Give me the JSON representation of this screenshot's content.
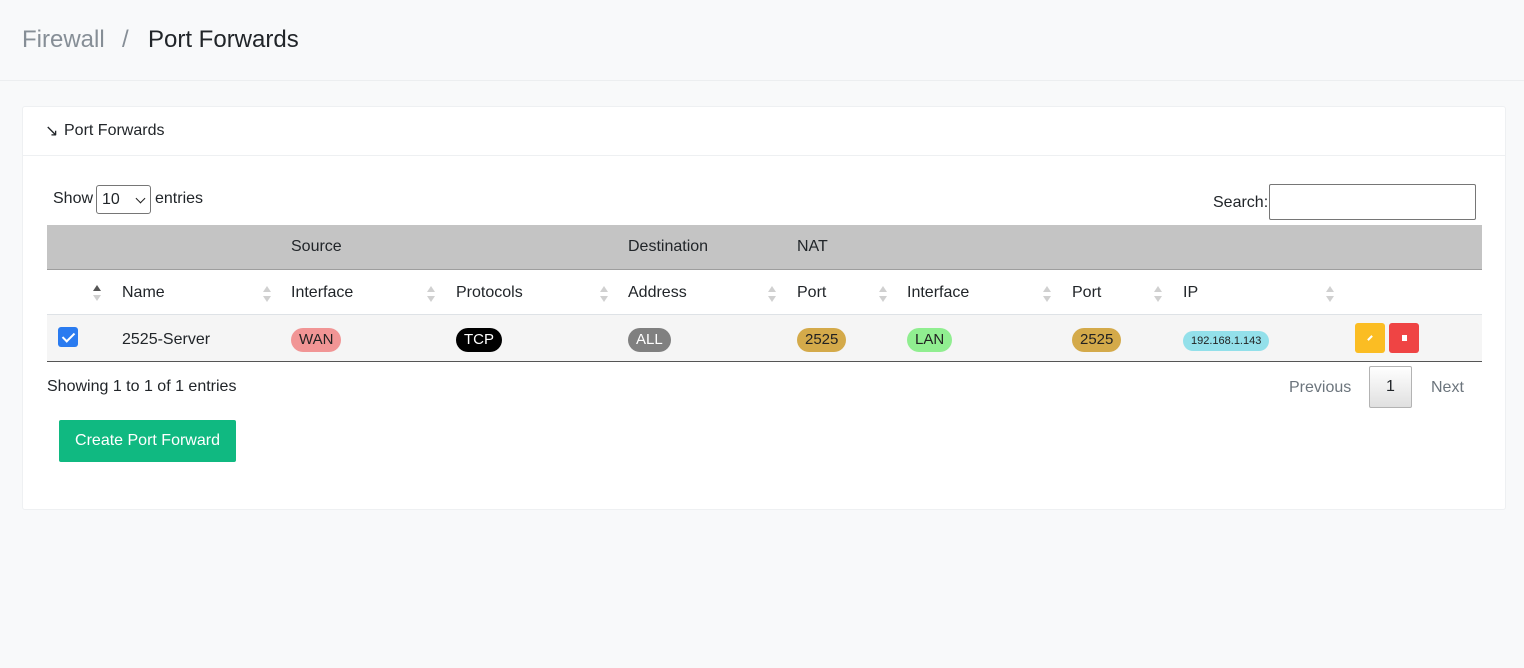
{
  "breadcrumb": {
    "parent": "Firewall",
    "separator": "/",
    "current": "Port Forwards"
  },
  "card": {
    "collapse_icon": "↘",
    "title": "Port Forwards"
  },
  "controls": {
    "show_label": "Show",
    "entries_value": "10",
    "entries_label": "entries",
    "search_label": "Search:",
    "search_value": ""
  },
  "table": {
    "groups": {
      "source": "Source",
      "destination": "Destination",
      "nat": "NAT"
    },
    "columns": {
      "name": "Name",
      "src_interface": "Interface",
      "protocols": "Protocols",
      "address": "Address",
      "dst_port": "Port",
      "nat_interface": "Interface",
      "nat_port": "Port",
      "ip": "IP"
    },
    "rows": [
      {
        "checked": true,
        "name": "2525-Server",
        "src_interface": "WAN",
        "protocols": "TCP",
        "address": "ALL",
        "dst_port": "2525",
        "nat_interface": "LAN",
        "nat_port": "2525",
        "ip": "192.168.1.143"
      }
    ]
  },
  "footer": {
    "info": "Showing 1 to 1 of 1 entries",
    "previous": "Previous",
    "page": "1",
    "next": "Next"
  },
  "create_button": "Create Port Forward",
  "colors": {
    "wan": "#f19595",
    "tcp": "#000000",
    "all": "#808080",
    "port": "#d4aa4a",
    "lan": "#90ee90",
    "ip": "#93e0ea",
    "edit": "#fbbd23",
    "delete": "#ef4444",
    "create": "#10b981",
    "checkbox": "#2a7bf0"
  },
  "icons": {
    "edit": "pencil-icon",
    "delete": "trash-icon"
  }
}
